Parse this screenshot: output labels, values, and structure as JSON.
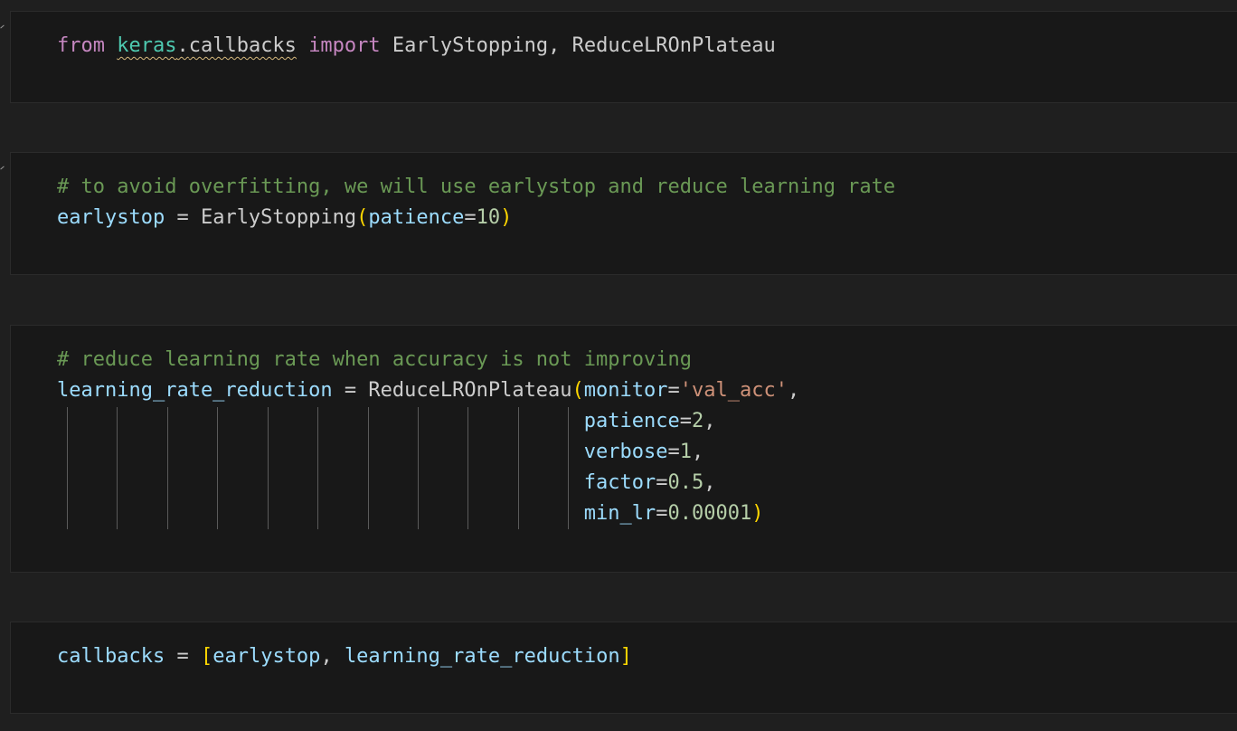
{
  "cells": [
    {
      "lines": [
        [
          {
            "t": "from ",
            "c": "kw"
          },
          {
            "t": "keras",
            "c": "mod squiggle"
          },
          {
            "t": ".",
            "c": "plain squiggle"
          },
          {
            "t": "callbacks",
            "c": "plain squiggle"
          },
          {
            "t": " ",
            "c": "plain"
          },
          {
            "t": "import",
            "c": "kw"
          },
          {
            "t": " EarlyStopping, ReduceLROnPlateau",
            "c": "plain"
          }
        ]
      ]
    },
    {
      "lines": [
        [
          {
            "t": "# to avoid overfitting, we will use earlystop and reduce learning rate",
            "c": "cmt"
          }
        ],
        [
          {
            "t": "earlystop",
            "c": "var"
          },
          {
            "t": " = EarlyStopping",
            "c": "plain"
          },
          {
            "t": "(",
            "c": "br1"
          },
          {
            "t": "patience",
            "c": "var"
          },
          {
            "t": "=",
            "c": "plain"
          },
          {
            "t": "10",
            "c": "num"
          },
          {
            "t": ")",
            "c": "br1"
          }
        ]
      ]
    },
    {
      "lines": [
        [
          {
            "t": "# reduce learning rate when accuracy is not improving",
            "c": "cmt"
          }
        ],
        [
          {
            "t": "learning_rate_reduction",
            "c": "var"
          },
          {
            "t": " = ReduceLROnPlateau",
            "c": "plain"
          },
          {
            "t": "(",
            "c": "br1"
          },
          {
            "t": "monitor",
            "c": "var"
          },
          {
            "t": "=",
            "c": "plain"
          },
          {
            "t": "'val_acc'",
            "c": "str"
          },
          {
            "t": ",",
            "c": "plain"
          }
        ],
        [
          {
            "t": "                                            ",
            "c": "plain"
          },
          {
            "t": "patience",
            "c": "var"
          },
          {
            "t": "=",
            "c": "plain"
          },
          {
            "t": "2",
            "c": "num"
          },
          {
            "t": ",",
            "c": "plain"
          }
        ],
        [
          {
            "t": "                                            ",
            "c": "plain"
          },
          {
            "t": "verbose",
            "c": "var"
          },
          {
            "t": "=",
            "c": "plain"
          },
          {
            "t": "1",
            "c": "num"
          },
          {
            "t": ",",
            "c": "plain"
          }
        ],
        [
          {
            "t": "                                            ",
            "c": "plain"
          },
          {
            "t": "factor",
            "c": "var"
          },
          {
            "t": "=",
            "c": "plain"
          },
          {
            "t": "0.5",
            "c": "num"
          },
          {
            "t": ",",
            "c": "plain"
          }
        ],
        [
          {
            "t": "                                            ",
            "c": "plain"
          },
          {
            "t": "min_lr",
            "c": "var"
          },
          {
            "t": "=",
            "c": "plain"
          },
          {
            "t": "0.00001",
            "c": "num"
          },
          {
            "t": ")",
            "c": "br1"
          }
        ]
      ]
    },
    {
      "lines": [
        [
          {
            "t": "callbacks",
            "c": "var"
          },
          {
            "t": " = ",
            "c": "plain"
          },
          {
            "t": "[",
            "c": "br1"
          },
          {
            "t": "earlystop",
            "c": "var"
          },
          {
            "t": ", ",
            "c": "plain"
          },
          {
            "t": "learning_rate_reduction",
            "c": "var"
          },
          {
            "t": "]",
            "c": "br1"
          }
        ]
      ]
    }
  ]
}
